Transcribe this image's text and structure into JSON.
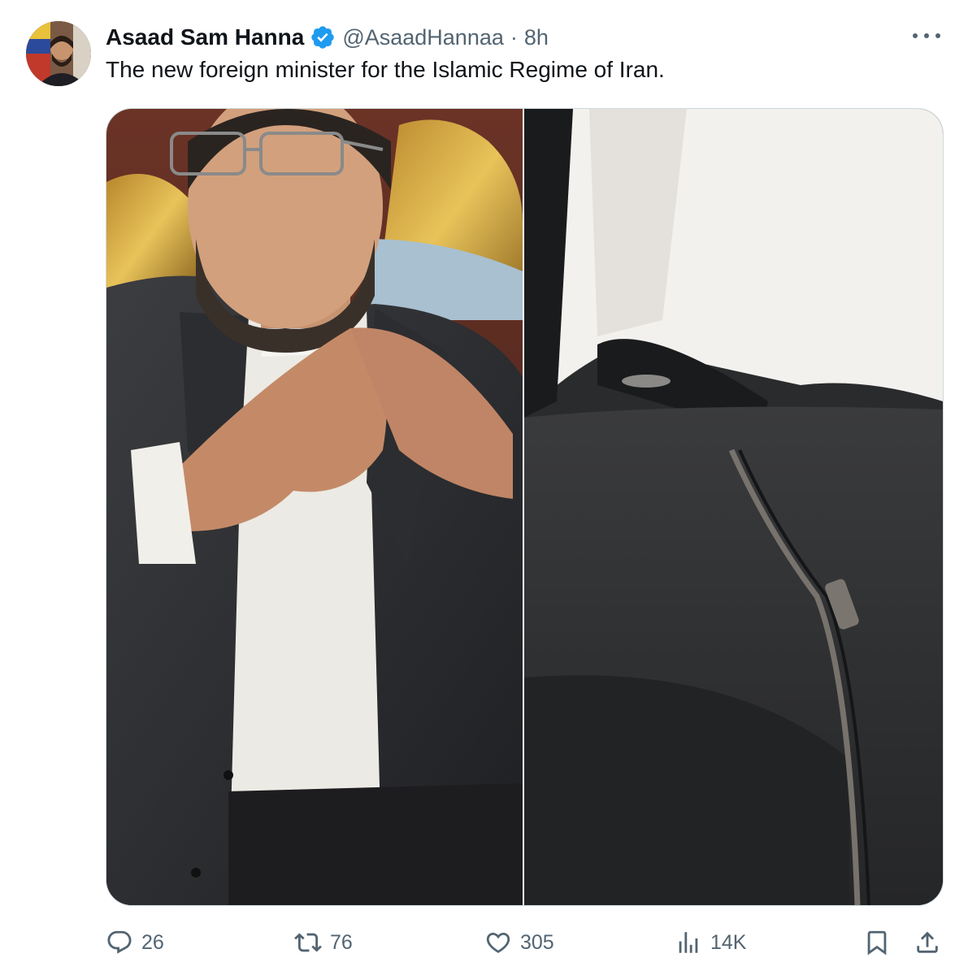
{
  "author": {
    "display_name": "Asaad Sam Hanna",
    "handle": "@AsaadHannaa",
    "separator": "·",
    "time_ago": "8h",
    "verified_color": "#1d9bf0"
  },
  "tweet": {
    "text": "The new foreign minister for the Islamic Regime of Iran."
  },
  "media": {
    "images": [
      {
        "name": "man-in-suit-photo"
      },
      {
        "name": "trousers-zipper-photo"
      }
    ]
  },
  "actions": {
    "reply": {
      "icon": "reply-icon",
      "count": "26"
    },
    "retweet": {
      "icon": "retweet-icon",
      "count": "76"
    },
    "like": {
      "icon": "heart-icon",
      "count": "305"
    },
    "views": {
      "icon": "views-chart-icon",
      "count": "14K"
    },
    "bookmark": {
      "icon": "bookmark-icon"
    },
    "share": {
      "icon": "share-icon"
    }
  },
  "colors": {
    "text_primary": "#0f1419",
    "text_secondary": "#536471",
    "border": "#cfd9de",
    "accent": "#1d9bf0"
  }
}
